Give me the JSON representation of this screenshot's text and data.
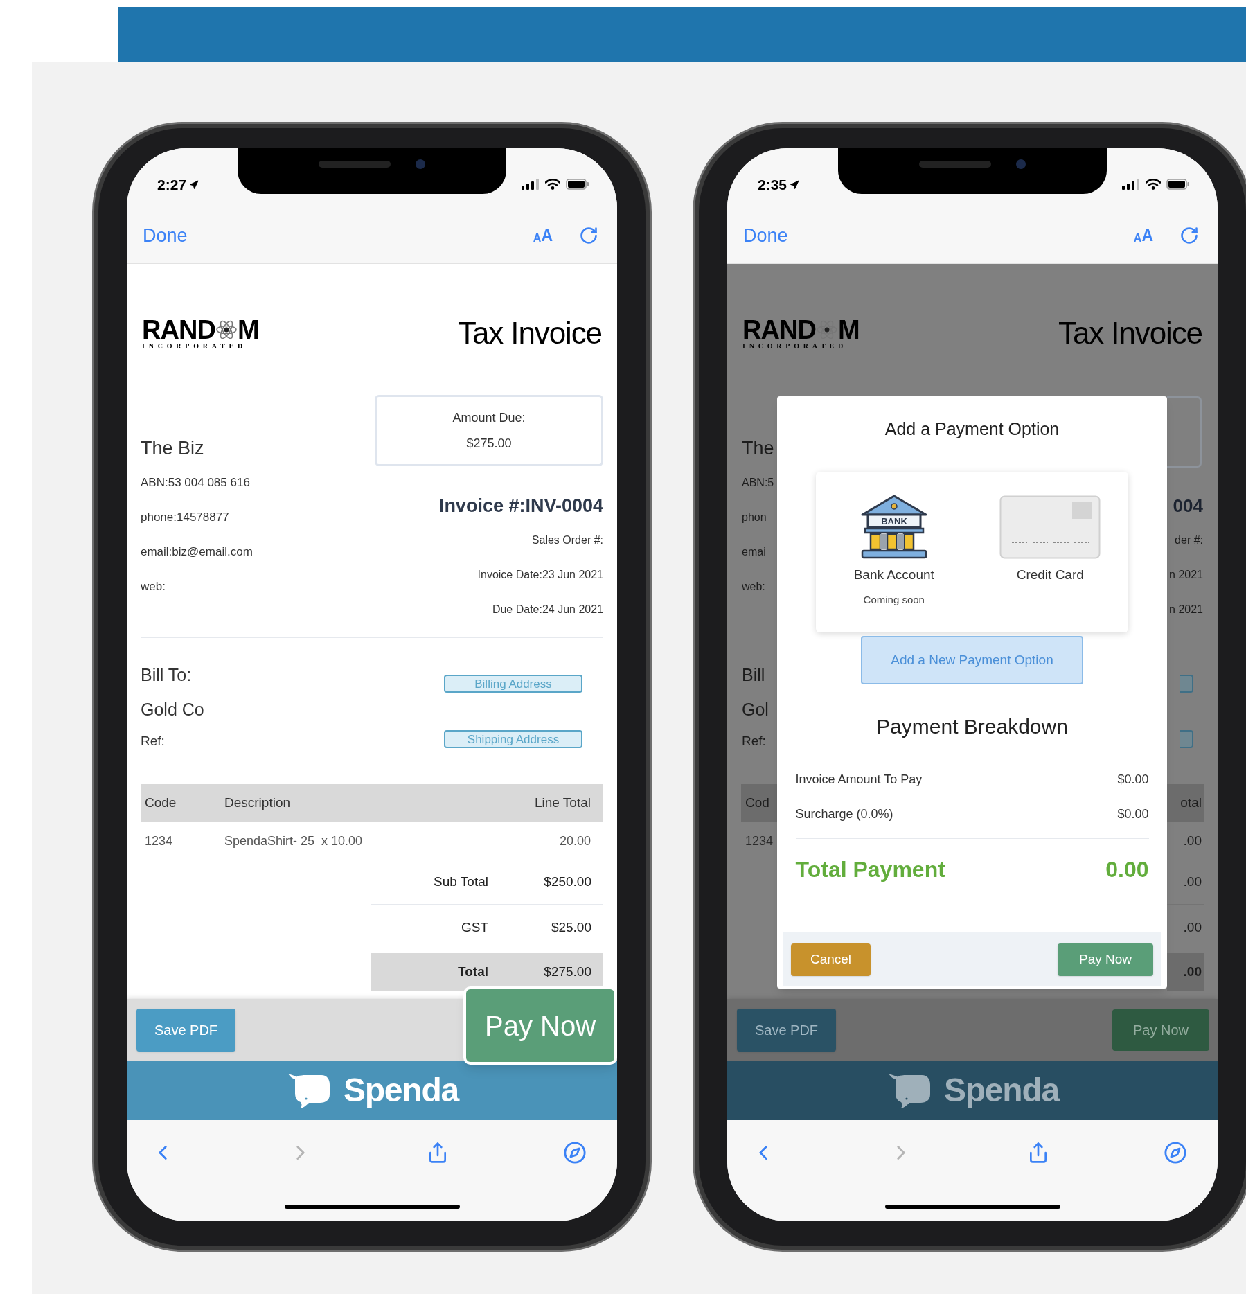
{
  "phones": [
    {
      "kind": "invoice",
      "status_bar": {
        "time": "2:27"
      },
      "browser_bar": {
        "done": "Done",
        "text_size": {
          "small": "A",
          "large": "A"
        }
      },
      "invoice": {
        "logo": {
          "before": "RAND",
          "after": "M",
          "tagline": "INCORPORATED"
        },
        "title": "Tax Invoice",
        "amount_due": {
          "label": "Amount Due:",
          "value": "$275.00"
        },
        "business": {
          "name": "The Biz",
          "lines": [
            "ABN:53 004 085 616",
            "phone:14578877",
            "email:biz@email.com",
            "web:"
          ]
        },
        "invoice_number": "Invoice #:INV-0004",
        "meta": [
          "Sales Order #:",
          "Invoice Date:23 Jun 2021",
          "Due Date:24 Jun 2021"
        ],
        "bill_to": {
          "label": "Bill To:",
          "name": "Gold Co",
          "ref": "Ref:"
        },
        "address_buttons": [
          "Billing Address",
          "Shipping Address"
        ],
        "table": {
          "columns": [
            "Code",
            "Description",
            "Line Total"
          ],
          "rows": [
            [
              "1234",
              "SpendaShirt- 25  x 10.00",
              "20.00"
            ]
          ]
        },
        "totals": [
          {
            "label": "Sub Total",
            "value": "$250.00",
            "highlighted": false
          },
          {
            "label": "GST",
            "value": "$25.00",
            "highlighted": false
          },
          {
            "label": "Total",
            "value": "$275.00",
            "highlighted": true
          }
        ]
      },
      "actions": {
        "save": "Save PDF",
        "pay": "Pay Now"
      },
      "brand": "Spenda",
      "toolbar": {
        "back_disabled": false,
        "forward_disabled": true
      }
    },
    {
      "kind": "payment_dialog",
      "status_bar": {
        "time": "2:35"
      },
      "browser_bar": {
        "done": "Done",
        "text_size": {
          "small": "A",
          "large": "A"
        }
      },
      "background": {
        "logo": {
          "before": "RAND",
          "after": "M",
          "tagline": "INCORPORATED"
        },
        "title": "Tax Invoice",
        "left": {
          "business": [
            "The",
            "ABN:5",
            "phon",
            "emai",
            "web:"
          ],
          "bill_to": [
            "Bill",
            "Gol",
            "Ref:"
          ],
          "table_header": "Cod",
          "table_row": "1234"
        },
        "right": {
          "invoice_number": "004",
          "meta": [
            "der #:",
            "n 2021",
            "n 2021"
          ],
          "table_header": "otal",
          "amounts": [
            ".00",
            ".00",
            ".00",
            ".00"
          ]
        }
      },
      "dialog": {
        "title": "Add a Payment Option",
        "options": [
          {
            "kind": "bank",
            "label": "Bank Account",
            "icon_text": "BANK",
            "note": "Coming soon"
          },
          {
            "kind": "card",
            "label": "Credit Card"
          }
        ],
        "add_button": "Add a New Payment Option",
        "breakdown_title": "Payment Breakdown",
        "rows": [
          {
            "label": "Invoice Amount To Pay",
            "value": "$0.00"
          },
          {
            "label": "Surcharge (0.0%)",
            "value": "$0.00"
          }
        ],
        "total": {
          "label": "Total Payment",
          "value": "0.00"
        },
        "cancel": "Cancel",
        "pay": "Pay Now"
      },
      "actions": {
        "save": "Save PDF",
        "pay": "Pay Now"
      },
      "brand": "Spenda",
      "toolbar": {
        "back_disabled": false,
        "forward_disabled": true
      }
    }
  ]
}
